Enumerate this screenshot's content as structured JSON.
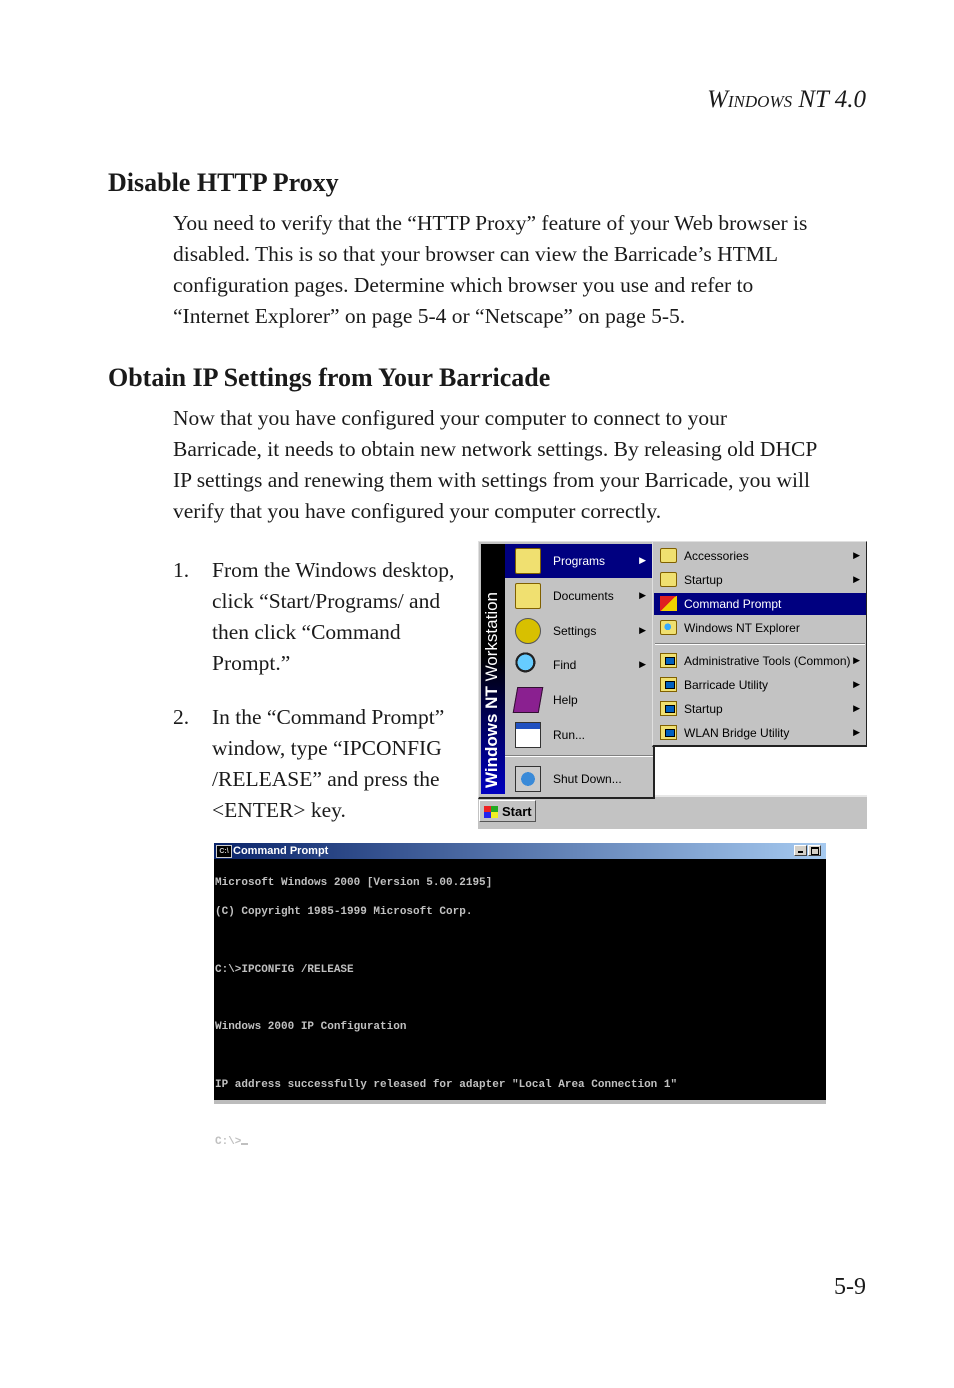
{
  "running_head": {
    "first_letter": "W",
    "small_caps": "INDOWS",
    "rest": " NT 4.0"
  },
  "sections": [
    {
      "heading": "Disable HTTP Proxy",
      "lines": [
        "You need to verify that the “HTTP Proxy” feature of your Web browser is",
        "disabled. This is so that your browser can view the Barricade’s HTML",
        "configuration pages. Determine which browser you use and refer to",
        "“Internet Explorer” on page 5-4 or “Netscape” on page 5-5."
      ]
    },
    {
      "heading": "Obtain IP Settings from Your Barricade",
      "lines": [
        "Now that you have configured your computer to connect to your",
        "Barricade, it needs to obtain new network settings. By releasing old DHCP",
        "IP settings and renewing them with settings from your Barricade, you will",
        "verify that you have configured your computer correctly."
      ]
    }
  ],
  "steps": [
    {
      "num": "1.",
      "lines": [
        "From the Windows desktop,",
        "click “Start/Programs/ and",
        "then click “Command",
        "Prompt.”"
      ]
    },
    {
      "num": "2.",
      "lines": [
        "In the “Command Prompt”",
        "window, type “IPCONFIG",
        "/RELEASE” and press the",
        "<ENTER> key."
      ]
    }
  ],
  "start_menu": {
    "banner_bold": "Windows NT",
    "banner_light": " Workstation",
    "items": [
      {
        "label": "Programs",
        "icon": "programs-icon",
        "submenu": true,
        "selected": true
      },
      {
        "label": "Documents",
        "icon": "documents-icon",
        "submenu": true
      },
      {
        "label": "Settings",
        "icon": "settings-icon",
        "submenu": true
      },
      {
        "label": "Find",
        "icon": "find-icon",
        "submenu": true
      },
      {
        "label": "Help",
        "icon": "help-icon",
        "submenu": false
      },
      {
        "label": "Run...",
        "icon": "run-icon",
        "submenu": false
      },
      {
        "label": "Shut Down...",
        "icon": "shutdown-icon",
        "submenu": false
      }
    ],
    "programs_submenu": [
      {
        "label": "Accessories",
        "submenu": true
      },
      {
        "label": "Startup",
        "submenu": true
      },
      {
        "label": "Command Prompt",
        "submenu": false,
        "selected": true
      },
      {
        "label": "Windows NT Explorer",
        "submenu": false
      },
      {
        "label": "Administrative Tools (Common)",
        "submenu": true
      },
      {
        "label": "Barricade Utility",
        "submenu": true
      },
      {
        "label": "Startup",
        "submenu": true
      },
      {
        "label": "WLAN Bridge Utility",
        "submenu": true
      }
    ],
    "start_label": "Start",
    "arrow": "▶"
  },
  "command_prompt": {
    "title": "Command Prompt",
    "icon_text": "C:\\",
    "lines": [
      "Microsoft Windows 2000 [Version 5.00.2195]",
      "(C) Copyright 1985-1999 Microsoft Corp.",
      "",
      "C:\\>IPCONFIG /RELEASE",
      "",
      "Windows 2000 IP Configuration",
      "",
      "IP address successfully released for adapter \"Local Area Connection 1\"",
      "",
      "C:\\>"
    ]
  },
  "folio": "5-9",
  "colors": {
    "menu_highlight": "#000080",
    "menu_bg": "#c3c3c3",
    "console_text": "#c0c0c0"
  }
}
